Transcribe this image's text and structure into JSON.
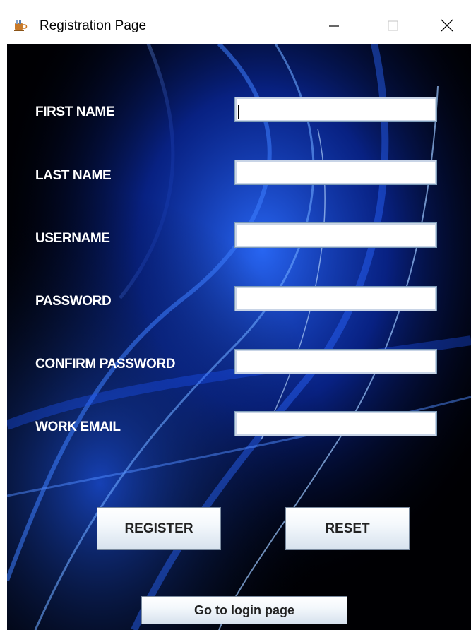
{
  "window": {
    "title": "Registration Page",
    "app_icon": "java-cup-icon",
    "controls": {
      "minimize_icon": "minimize-icon",
      "maximize_icon": "maximize-icon",
      "close_icon": "close-icon"
    }
  },
  "form": {
    "fields": [
      {
        "label": "FIRST NAME",
        "value": "",
        "focused": true
      },
      {
        "label": "LAST NAME",
        "value": ""
      },
      {
        "label": "USERNAME",
        "value": ""
      },
      {
        "label": "PASSWORD",
        "value": ""
      },
      {
        "label": "CONFIRM PASSWORD",
        "value": ""
      },
      {
        "label": "WORK EMAIL",
        "value": ""
      }
    ],
    "register_label": "REGISTER",
    "reset_label": "RESET",
    "login_label": "Go to login page"
  },
  "colors": {
    "background": "#000000",
    "accent_blue": "#1e5bff",
    "label_text": "#ffffff"
  }
}
